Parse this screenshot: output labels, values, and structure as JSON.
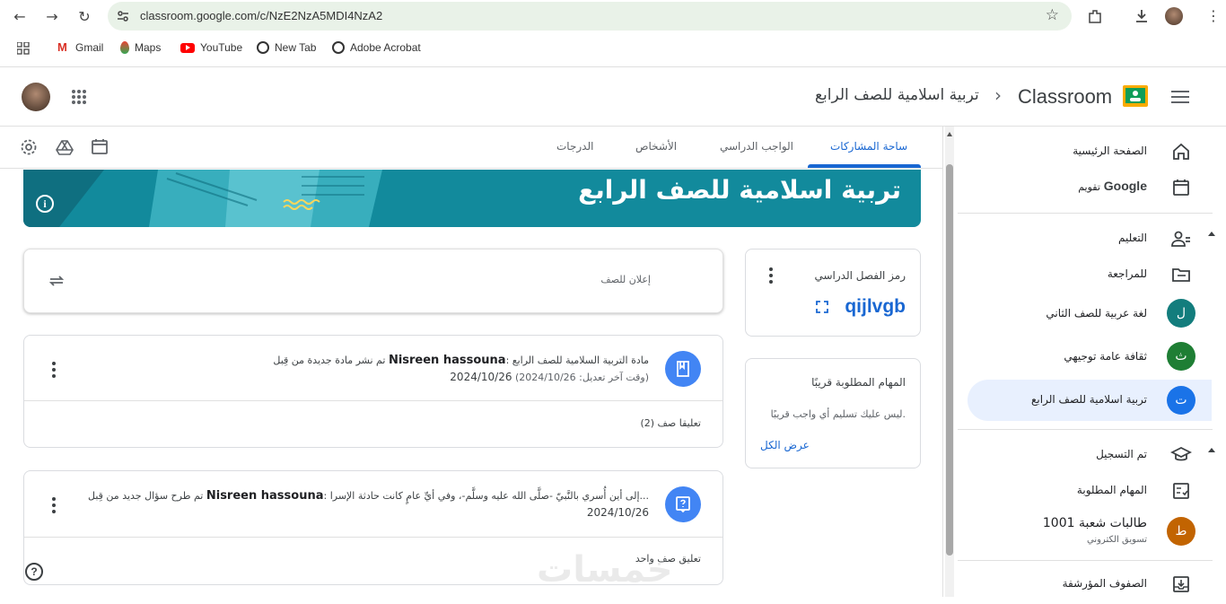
{
  "browser": {
    "url": "classroom.google.com/c/NzE2NzA5MDI4NzA2",
    "bookmarks": [
      "Gmail",
      "Maps",
      "YouTube",
      "New Tab",
      "Adobe Acrobat"
    ]
  },
  "header": {
    "brand": "Classroom",
    "chevron": "›",
    "class_name": "تربية اسلامية للصف الرابع"
  },
  "tabs": [
    "ساحة المشاركات",
    "الواجب الدراسي",
    "الأشخاص",
    "الدرجات"
  ],
  "banner": {
    "title": "تربية اسلامية للصف الرابع"
  },
  "class_code": {
    "label": "رمز الفصل الدراسي",
    "code": "qijlvgb"
  },
  "upcoming": {
    "title": "المهام المطلوبة قريبًا",
    "empty_text": "ليس عليك تسليم أي واجب قريبًا.",
    "view_all": "عرض الكل"
  },
  "announce": {
    "placeholder": "إعلان للصف"
  },
  "posts": [
    {
      "prefix": "تم نشر مادة جديدة من قِبل",
      "author": "Nisreen hassouna",
      "suffix": ": مادة التربية السلامية للصف الرابع",
      "date": "2024/10/26",
      "edited": "(وقت آخر تعديل: 2024/10/26)",
      "comments": "تعليقا صف (2)"
    },
    {
      "prefix": "تم طرح سؤال جديد من قِبل",
      "author": "Nisreen hassouna",
      "suffix": ": إلى أين أُسري بالنَّبيّ -صلَّى الله عليه وسلَّم-، وفي أيِّ عامٍ كانت حادثة الإسرا...",
      "date": "2024/10/26",
      "comments": "تعليق صف واحد"
    }
  ],
  "sidebar": {
    "home": "الصفحة الرئيسية",
    "calendar_prefix": "تقويم",
    "calendar_brand": "Google",
    "teaching": "التعليم",
    "review": "للمراجعة",
    "classes": [
      {
        "initial": "ل",
        "name": "لغة عربية للصف الثاني",
        "color": "#137d7d"
      },
      {
        "initial": "ث",
        "name": "ثقافة عامة توجيهي",
        "color": "#1e7e34"
      },
      {
        "initial": "ت",
        "name": "تربية اسلامية للصف الرابع",
        "color": "#1a73e8"
      }
    ],
    "enrolled": "تم التسجيل",
    "todo": "المهام المطلوبة",
    "enrolled_class": {
      "initial": "ط",
      "name": "طالبات شعبة 1001",
      "sub": "تسويق الكتروني",
      "color": "#c26401"
    },
    "archived": "الصفوف المؤرشفة"
  },
  "watermark": "خمسات"
}
